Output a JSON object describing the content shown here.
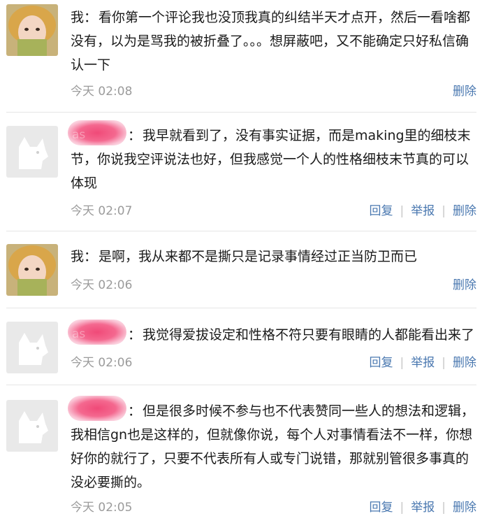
{
  "comments": [
    {
      "author": "我",
      "separator": "：",
      "text": "看你第一个评论我也没顶我真的纠结半天才点开，然后一看啥都没有，以为是骂我的被折叠了。。。想屏蔽吧，又不能确定只好私信确认一下",
      "time": "今天 02:08",
      "actions": [
        "删除"
      ]
    },
    {
      "author": "as",
      "separator": "：",
      "text": "我早就看到了，没有事实证据，而是making里的细枝末节，你说我空评说法也好，但我感觉一个人的性格细枝末节真的可以体现",
      "time": "今天 02:07",
      "actions": [
        "回复",
        "举报",
        "删除"
      ]
    },
    {
      "author": "我",
      "separator": "：",
      "text": "是啊，我从来都不是撕只是记录事情经过正当防卫而已",
      "time": "今天 02:06",
      "actions": [
        "删除"
      ]
    },
    {
      "author": "as",
      "separator": "：",
      "text": "我觉得爱拔设定和性格不符只要有眼睛的人都能看出来了",
      "time": "今天 02:06",
      "actions": [
        "回复",
        "举报",
        "删除"
      ]
    },
    {
      "author": "",
      "separator": "：",
      "text": "但是很多时候不参与也不代表赞同一些人的想法和逻辑，我相信gn也是这样的，但就像你说，每个人对事情看法不一样，你想好你的就行了，只要不代表所有人或专门说错，那就别管很多事真的没必要撕的。",
      "time": "今天 02:05",
      "actions": [
        "回复",
        "举报",
        "删除"
      ]
    }
  ],
  "colors": {
    "link": "#4a78b0",
    "time": "#9b9b9b",
    "blur": "#f04a78"
  },
  "icons": {
    "self_avatar": "user-photo-avatar",
    "other_avatar": "default-dog-avatar"
  }
}
